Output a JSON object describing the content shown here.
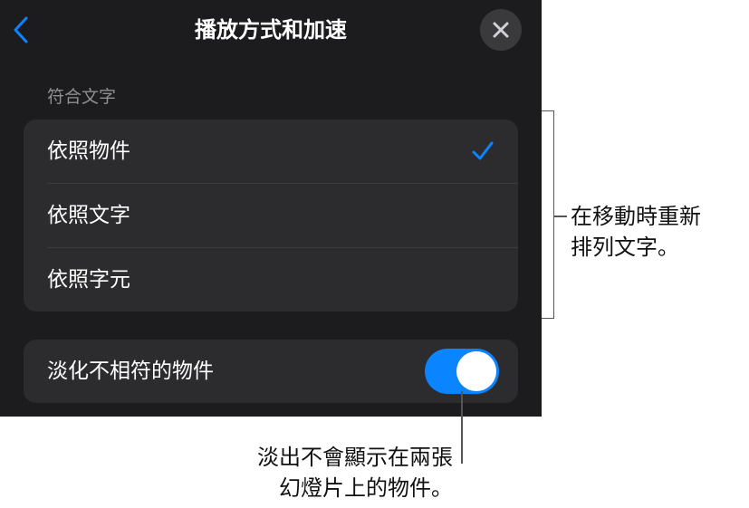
{
  "header": {
    "title": "播放方式和加速"
  },
  "section": {
    "label": "符合文字"
  },
  "options": [
    {
      "label": "依照物件",
      "selected": true
    },
    {
      "label": "依照文字",
      "selected": false
    },
    {
      "label": "依照字元",
      "selected": false
    }
  ],
  "toggle_row": {
    "label": "淡化不相符的物件",
    "on": true
  },
  "callouts": {
    "right_line1": "在移動時重新",
    "right_line2": "排列文字。",
    "bottom_line1": "淡出不會顯示在兩張",
    "bottom_line2": "幻燈片上的物件。"
  },
  "colors": {
    "accent": "#0a84ff",
    "panel": "#1c1c1e",
    "group": "#2c2c2e"
  },
  "icons": {
    "back": "chevron-left-icon",
    "close": "close-icon",
    "check": "checkmark-icon"
  }
}
